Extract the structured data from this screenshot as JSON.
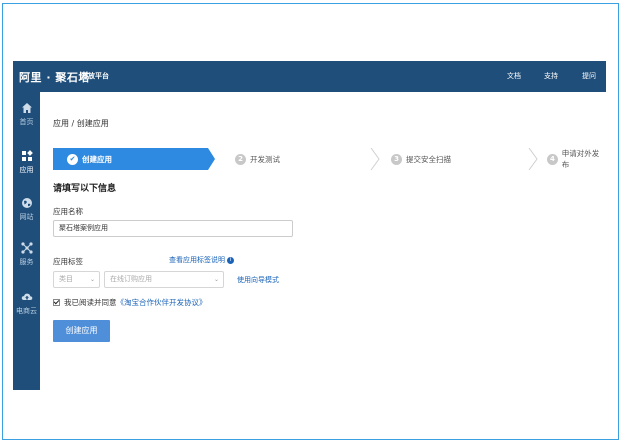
{
  "topbar": {
    "brand": "阿里 · 聚石塔",
    "brand_sub": "开放平台",
    "nav": {
      "docs": "文档",
      "support": "支持",
      "ticket": "提问"
    }
  },
  "sidebar": {
    "items": [
      {
        "label": "首页",
        "icon": "home-icon"
      },
      {
        "label": "应用",
        "icon": "grid-icon",
        "active": true
      },
      {
        "label": "网站",
        "icon": "globe-icon"
      },
      {
        "label": "服务",
        "icon": "network-icon"
      },
      {
        "label": "电商云",
        "icon": "cloud-upload-icon"
      }
    ]
  },
  "breadcrumb": "应用 / 创建应用",
  "steps": [
    {
      "num": "✔",
      "label": "创建应用",
      "active": true
    },
    {
      "num": "2",
      "label": "开发测试"
    },
    {
      "num": "3",
      "label": "提交安全扫描"
    },
    {
      "num": "4",
      "label": "申请对外发布"
    }
  ],
  "form": {
    "section_title": "请填写以下信息",
    "app_name_label": "应用名称",
    "app_name_value": "聚石塔案例应用",
    "app_tag_label": "应用标签",
    "tag_help_link": "查看应用标签说明",
    "tag_category_placeholder": "类目",
    "tag_sub_placeholder": "在线订购应用",
    "guide_mode_link": "使用向导模式",
    "agree_text": "我已阅读并同意",
    "agree_link": "《淘宝合作伙伴开发协议》",
    "agree_checked": true,
    "submit_label": "创建应用"
  },
  "colors": {
    "header_bg": "#1f4e7a",
    "accent": "#2d8ae0",
    "link": "#1a63b8",
    "button": "#4f8fda"
  }
}
